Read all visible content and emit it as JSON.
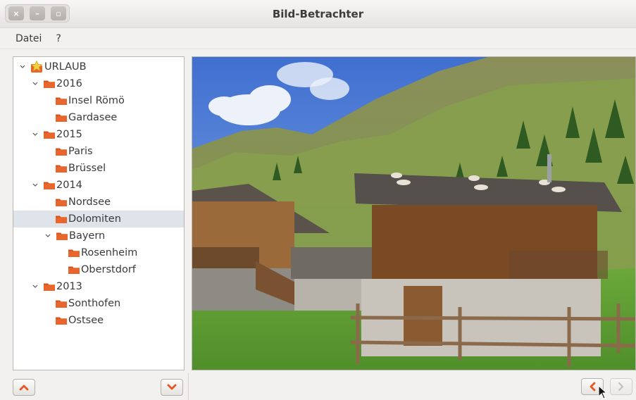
{
  "window": {
    "title": "Bild-Betrachter",
    "controls": [
      "×",
      "–",
      "▫"
    ]
  },
  "menu": {
    "items": [
      "Datei",
      "?"
    ]
  },
  "tree": {
    "root": "URLAUB",
    "years": [
      {
        "label": "2016",
        "items": [
          "Insel Römö",
          "Gardasee"
        ]
      },
      {
        "label": "2015",
        "items": [
          "Paris",
          "Brüssel"
        ]
      },
      {
        "label": "2014",
        "items": [
          "Nordsee",
          "Dolomiten"
        ],
        "sub": {
          "label": "Bayern",
          "items": [
            "Rosenheim",
            "Oberstdorf"
          ]
        }
      },
      {
        "label": "2013",
        "items": [
          "Sonthofen",
          "Ostsee"
        ]
      }
    ],
    "selected": "Dolomiten"
  },
  "colors": {
    "accent": "#e95420",
    "folder": "#e8662c",
    "selection": "#dfe3ea"
  },
  "icons": {
    "tree_up": "chevron-up-icon",
    "tree_down": "chevron-down-icon",
    "prev": "chevron-left-icon",
    "next": "chevron-right-icon"
  }
}
